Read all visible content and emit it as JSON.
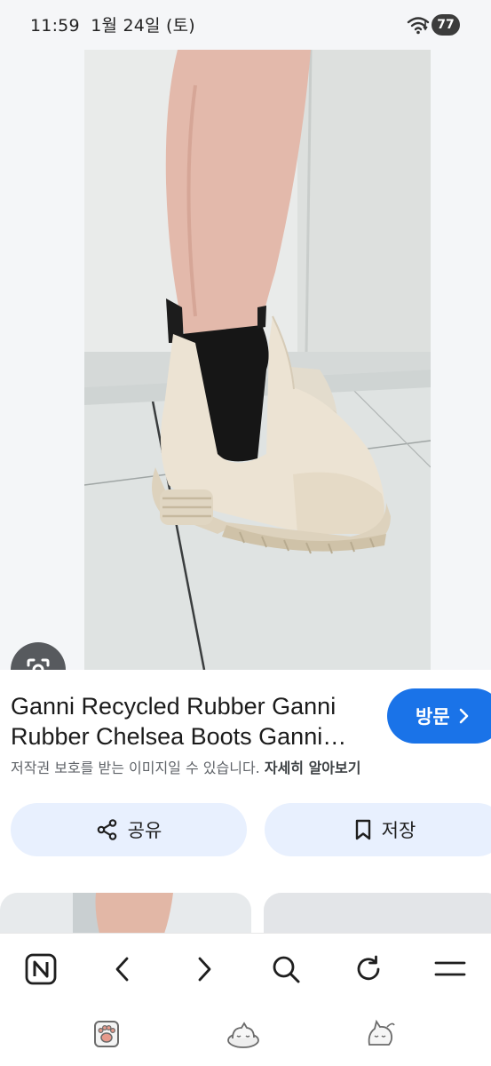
{
  "status_bar": {
    "time": "11:59",
    "date": "1월 24일 (토)",
    "battery": "77"
  },
  "image_viewer": {
    "lens_icon": "camera-lens-icon"
  },
  "result": {
    "title_line1": "Ganni Recycled Rubber Ganni",
    "title_line2": "Rubber Chelsea Boots Ganni…",
    "visit_label": "방문",
    "copyright_text": "저작권 보호를 받는 이미지일 수 있습니다.",
    "learn_more": "자세히 알아보기",
    "share_label": "공유",
    "save_label": "저장"
  },
  "browser_nav": {
    "items": [
      "naver-home-icon",
      "back-icon",
      "forward-icon",
      "search-icon",
      "refresh-icon",
      "menu-icon"
    ]
  },
  "system_bar": {
    "items": [
      "paw-icon",
      "cat-bed-icon",
      "cat-icon"
    ]
  },
  "colors": {
    "accent": "#1a73e8",
    "pill_bg": "#e8f0fe"
  }
}
